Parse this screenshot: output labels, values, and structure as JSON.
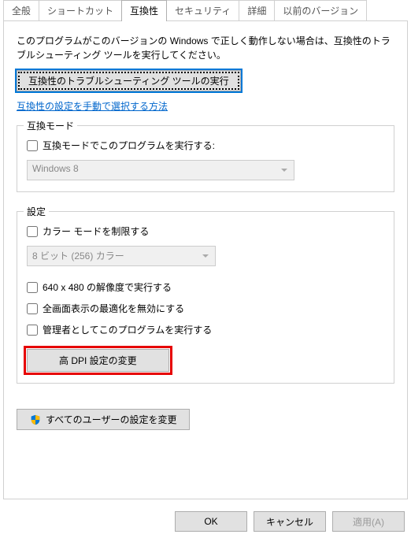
{
  "tabs": {
    "general": "全般",
    "shortcut": "ショートカット",
    "compat": "互換性",
    "security": "セキュリティ",
    "details": "詳細",
    "prev": "以前のバージョン"
  },
  "panel": {
    "desc": "このプログラムがこのバージョンの Windows で正しく動作しない場合は、互換性のトラブルシューティング ツールを実行してください。",
    "troubleshoot_btn": "互換性のトラブルシューティング ツールの実行",
    "manual_link": "互換性の設定を手動で選択する方法"
  },
  "compat_mode": {
    "title": "互換モード",
    "checkbox": "互換モードでこのプログラムを実行する:",
    "combo_value": "Windows 8"
  },
  "settings": {
    "title": "設定",
    "color_limit": "カラー モードを制限する",
    "color_combo": "8 ビット (256) カラー",
    "res640": "640 x 480 の解像度で実行する",
    "fullscreen_opt": "全画面表示の最適化を無効にする",
    "run_admin": "管理者としてこのプログラムを実行する",
    "highdpi_btn": "高 DPI 設定の変更"
  },
  "allusers_btn": "すべてのユーザーの設定を変更",
  "footer": {
    "ok": "OK",
    "cancel": "キャンセル",
    "apply": "適用(A)"
  }
}
